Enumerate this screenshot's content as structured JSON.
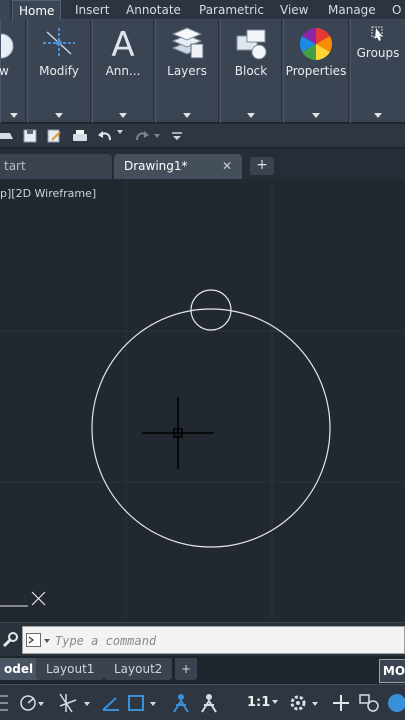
{
  "ribbon_tabs": [
    {
      "label": "Home",
      "active": true
    },
    {
      "label": "Insert"
    },
    {
      "label": "Annotate"
    },
    {
      "label": "Parametric"
    },
    {
      "label": "View"
    },
    {
      "label": "Manage"
    },
    {
      "label": "O"
    }
  ],
  "ribbon_panels": {
    "draw": "w",
    "modify": "Modify",
    "annotation": "Ann...",
    "layers": "Layers",
    "block": "Block",
    "properties": "Properties",
    "groups": "Groups"
  },
  "file_tabs": {
    "start": "tart",
    "drawing": "Drawing1*",
    "close_glyph": "✕",
    "new_tab_glyph": "+"
  },
  "viewport": {
    "label": "p][2D Wireframe]"
  },
  "command_line": {
    "placeholder": "Type a command"
  },
  "layout_tabs": {
    "model": "odel",
    "layout1": "Layout1",
    "layout2": "Layout2",
    "add_glyph": "+"
  },
  "status_bar": {
    "model_space": "MO",
    "annotation_scale": "1:1"
  },
  "colors": {
    "canvas_bg": "#212830",
    "ribbon_bg": "#3a4452",
    "accent_blue": "#3a8fd9",
    "geometry_white": "#e6e6e6"
  }
}
